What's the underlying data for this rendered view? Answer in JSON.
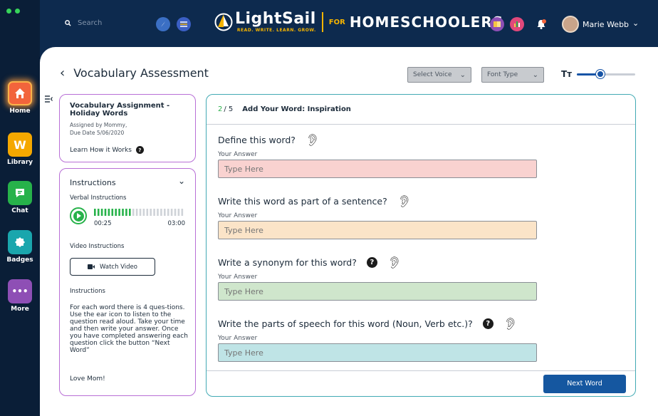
{
  "sidebar": {
    "items": [
      {
        "label": "Home",
        "icon": "home-icon",
        "color": "#f2643c"
      },
      {
        "label": "Library",
        "icon": "library-icon",
        "color": "#f5a800",
        "glyph": "W"
      },
      {
        "label": "Chat",
        "icon": "chat-icon",
        "color": "#27b24a"
      },
      {
        "label": "Badges",
        "icon": "badge-icon",
        "color": "#1aa6ad"
      },
      {
        "label": "More",
        "icon": "more-icon",
        "color": "#8e4fb5",
        "glyph": "•••"
      }
    ]
  },
  "topbar": {
    "search_placeholder": "Search",
    "logo_name": "LightSail",
    "logo_tagline": "READ. WRITE. LEARN. GROW.",
    "logo_for": "FOR",
    "logo_audience": "HOMESCHOOLERS",
    "user_name": "Marie Webb",
    "caret": "⌄"
  },
  "page": {
    "back": "‹",
    "title": "Vocabulary Assessment",
    "voice_select": "Select Voice",
    "font_select": "Font Type",
    "text_size_label": "Tт",
    "font_size_level": 0.4
  },
  "assignment": {
    "title": "Vocabulary Assignment - Holiday Words",
    "assigned_by": "Assigned by Mommy,",
    "due": "Due Date 5/06/2020",
    "learn_link": "Learn How it Works",
    "help": "?"
  },
  "instructions": {
    "heading": "Instructions",
    "verbal_label": "Verbal Instructions",
    "time_current": "00:25",
    "time_total": "03:00",
    "audio_progress": 0.14,
    "video_label": "Video Instructions",
    "watch_button": "Watch Video",
    "text_label": "Instructions",
    "body": "For each word there is 4 ques-tions. Use the ear icon to listen to the question read aloud. Take your time and then write your answer. Once you have completed answering each question click the button “Next Word”",
    "signoff": "Love Mom!"
  },
  "questions_panel": {
    "progress_current": "2",
    "progress_total": "/ 5",
    "header_title": "Add Your Word: Inspiration",
    "answer_label": "Your Answer",
    "help": "?",
    "ear": "𝄐",
    "questions": [
      {
        "text": "Define this word?",
        "placeholder": "Type Here",
        "help": false,
        "color": "#f9d2d0"
      },
      {
        "text": "Write this word as part of a sentence?",
        "placeholder": "Type Here",
        "help": false,
        "color": "#fbe4c8"
      },
      {
        "text": "Write a synonym for this word?",
        "placeholder": "Type Here",
        "help": true,
        "color": "#cfe6cc"
      },
      {
        "text": "Write the parts of speech for this word (Noun, Verb etc.)?",
        "placeholder": "Type Here",
        "help": true,
        "color": "#bfe4e6"
      }
    ],
    "next_button": "Next Word"
  }
}
